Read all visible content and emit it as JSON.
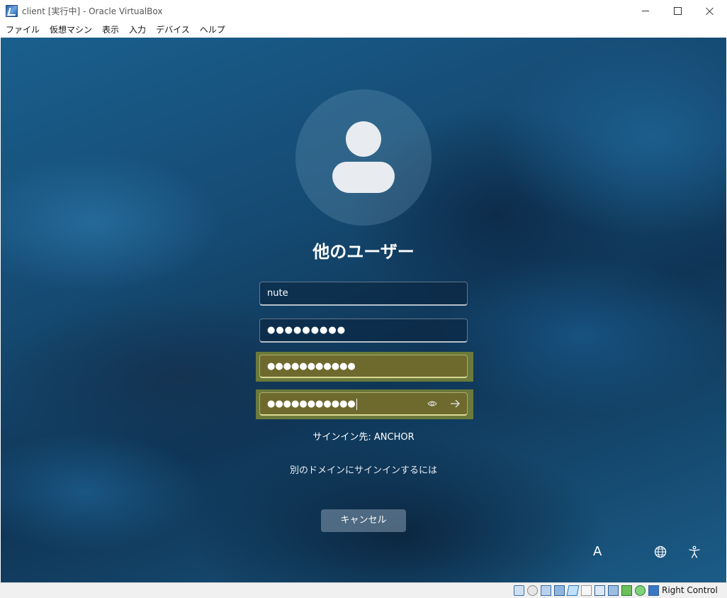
{
  "window": {
    "title": "client [実行中] - Oracle VirtualBox"
  },
  "menu": {
    "items": [
      "ファイル",
      "仮想マシン",
      "表示",
      "入力",
      "デバイス",
      "ヘルプ"
    ]
  },
  "login": {
    "heading": "他のユーザー",
    "username_value": "nute",
    "current_password_mask": "●●●●●●●●●",
    "new_password_mask": "●●●●●●●●●●●",
    "confirm_password_mask": "●●●●●●●●●●●",
    "sign_in_to": "サインイン先: ANCHOR",
    "other_domain_link": "別のドメインにサインインするには",
    "cancel_label": "キャンセル",
    "ime_indicator": "A"
  },
  "statusbar": {
    "host_key": "Right Control"
  },
  "colors": {
    "highlight": "#6b7a3a",
    "wallpaper": "#154a72"
  }
}
